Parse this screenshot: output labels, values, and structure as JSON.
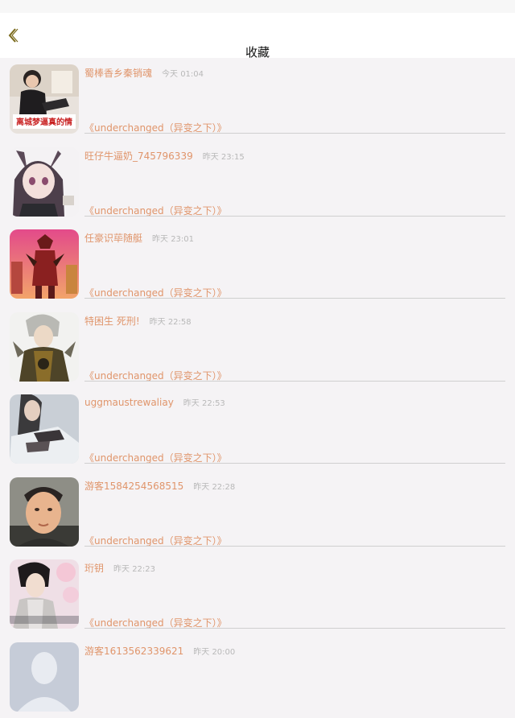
{
  "header": {
    "title": "收藏"
  },
  "items": [
    {
      "user": "蜀棒香乡秦销魂",
      "time": "今天 01:04",
      "book": "《underchanged（异变之下）》",
      "avatar_text": "离城梦逼真的情"
    },
    {
      "user": "旺仔牛逼奶_745796339",
      "time": "昨天 23:15",
      "book": "《underchanged（异变之下）》"
    },
    {
      "user": "任豪识荜随艇",
      "time": "昨天 23:01",
      "book": "《underchanged（异变之下）》"
    },
    {
      "user": "特困生 死刑!",
      "time": "昨天 22:58",
      "book": "《underchanged（异变之下）》"
    },
    {
      "user": "uggmaustrewaliay",
      "time": "昨天 22:53",
      "book": "《underchanged（异变之下）》"
    },
    {
      "user": "游客1584254568515",
      "time": "昨天 22:28",
      "book": "《underchanged（异变之下）》"
    },
    {
      "user": "珩钥",
      "time": "昨天 22:23",
      "book": "《underchanged（异变之下）》"
    },
    {
      "user": "游客1613562339621",
      "time": "昨天 20:00",
      "book": ""
    }
  ]
}
